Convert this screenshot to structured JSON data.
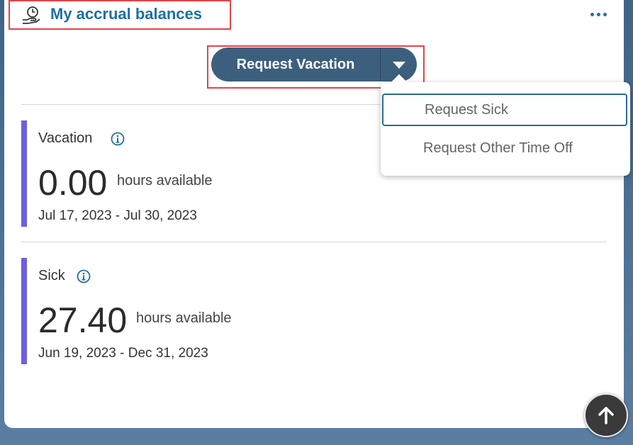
{
  "widget": {
    "title": "My accrual balances",
    "icon": "clock-hand-icon",
    "menu_icon": "more-options-icon"
  },
  "request_button": {
    "label": "Request Vacation",
    "toggle_icon": "caret-down-icon"
  },
  "dropdown": {
    "items": [
      {
        "label": "Request Sick",
        "focused": true
      },
      {
        "label": "Request Other Time Off",
        "focused": false
      }
    ]
  },
  "balances": [
    {
      "label": "Vacation",
      "value": "0.00",
      "unit": "hours available",
      "range": "Jul 17, 2023 - Jul 30, 2023"
    },
    {
      "label": "Sick",
      "value": "27.40",
      "unit": "hours available",
      "range": "Jun 19, 2023 - Dec 31, 2023"
    }
  ],
  "colors": {
    "accent": "#1f6fa3",
    "button_bg": "#3d5f7e",
    "balance_bar": "#6e5fe0",
    "highlight_box": "#e0454a"
  },
  "scroll_top_icon": "arrow-up-icon"
}
